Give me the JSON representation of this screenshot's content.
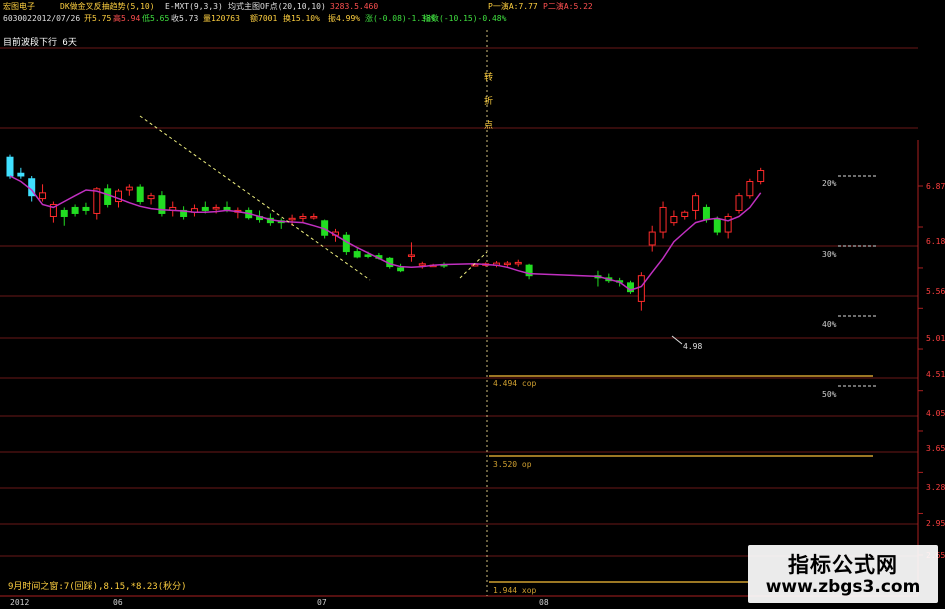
{
  "header": {
    "stock_name": "宏图电子",
    "indicator1": "DK做金叉反抽趋势(5,10)",
    "indicator2": "E-MXT(9,3,3)",
    "indicator3": "均式主图OF点(20,10,10)",
    "indicator3_value": "3283.5.460",
    "right_label1": "P一演A:7.77",
    "right_label2": "P二演A:5.22",
    "code": "603002",
    "date": "2012/07/26",
    "open_label": "开5.75",
    "high_label": "高5.94",
    "low_label": "低5.65",
    "close_label": "收5.73",
    "volume_label": "量120763",
    "amount_label": "额7001",
    "turnover_label": "换15.10%",
    "amplitude_label": "振4.99%",
    "change_label": "涨(-0.08)-1.38%",
    "index_label": "指数(-10.15)-0.48%",
    "trend_label": "目前波段下行 6天"
  },
  "annotations": {
    "turn_label": "转折点",
    "low_price": "4.98",
    "pct_20": "20%",
    "pct_30": "30%",
    "pct_40": "40%",
    "pct_50": "50%",
    "level1": "4.494 cop",
    "level2": "3.520 op",
    "level3": "1.944 xop"
  },
  "price_axis": [
    "6.87",
    "6.18",
    "5.56",
    "5.01",
    "4.51",
    "4.05",
    "3.65",
    "3.28",
    "2.95",
    "2.65"
  ],
  "date_axis": [
    "2012",
    "06",
    "07",
    "08"
  ],
  "footer_text": "9月时间之窗:7(回踩),8.15,*8.23(秋分)",
  "watermark": {
    "line1": "指标公式网",
    "line2": "www.zbgs3.com"
  },
  "colors": {
    "up": "#ff2b2b",
    "down": "#22dd22",
    "ma": "#c030c0",
    "cyan": "#40e0ff",
    "gold": "#d0a030",
    "grid": "#6a1818"
  },
  "chart_data": {
    "type": "candlestick",
    "y_axis_scale": "log",
    "y_ticks": [
      6.87,
      6.18,
      5.56,
      5.01,
      4.51,
      4.05,
      3.65,
      3.28,
      2.95,
      2.65
    ],
    "x_tick_labels": [
      "2012",
      "06",
      "07",
      "08"
    ],
    "candles": [
      {
        "o": 7.4,
        "h": 7.45,
        "l": 7.0,
        "c": 7.05,
        "color": "cyan"
      },
      {
        "o": 7.1,
        "h": 7.2,
        "l": 7.0,
        "c": 7.05,
        "color": "cyan"
      },
      {
        "o": 7.0,
        "h": 7.05,
        "l": 6.6,
        "c": 6.7,
        "color": "cyan"
      },
      {
        "o": 6.75,
        "h": 6.9,
        "l": 6.6,
        "c": 6.65,
        "color": "up"
      },
      {
        "o": 6.55,
        "h": 6.6,
        "l": 6.25,
        "c": 6.35,
        "color": "up"
      },
      {
        "o": 6.35,
        "h": 6.5,
        "l": 6.2,
        "c": 6.45,
        "color": "down"
      },
      {
        "o": 6.5,
        "h": 6.55,
        "l": 6.35,
        "c": 6.4,
        "color": "down"
      },
      {
        "o": 6.5,
        "h": 6.58,
        "l": 6.38,
        "c": 6.45,
        "color": "down"
      },
      {
        "o": 6.4,
        "h": 6.85,
        "l": 6.3,
        "c": 6.82,
        "color": "up"
      },
      {
        "o": 6.82,
        "h": 6.9,
        "l": 6.5,
        "c": 6.55,
        "color": "down"
      },
      {
        "o": 6.6,
        "h": 6.82,
        "l": 6.5,
        "c": 6.78,
        "color": "up"
      },
      {
        "o": 6.8,
        "h": 6.9,
        "l": 6.7,
        "c": 6.85,
        "color": "up"
      },
      {
        "o": 6.85,
        "h": 6.9,
        "l": 6.55,
        "c": 6.6,
        "color": "down"
      },
      {
        "o": 6.65,
        "h": 6.75,
        "l": 6.55,
        "c": 6.7,
        "color": "up"
      },
      {
        "o": 6.7,
        "h": 6.78,
        "l": 6.35,
        "c": 6.4,
        "color": "down"
      },
      {
        "o": 6.45,
        "h": 6.6,
        "l": 6.35,
        "c": 6.5,
        "color": "up"
      },
      {
        "o": 6.45,
        "h": 6.52,
        "l": 6.3,
        "c": 6.35,
        "color": "down"
      },
      {
        "o": 6.42,
        "h": 6.55,
        "l": 6.35,
        "c": 6.48,
        "color": "up"
      },
      {
        "o": 6.5,
        "h": 6.6,
        "l": 6.4,
        "c": 6.45,
        "color": "down"
      },
      {
        "o": 6.48,
        "h": 6.55,
        "l": 6.4,
        "c": 6.5,
        "color": "up"
      },
      {
        "o": 6.5,
        "h": 6.6,
        "l": 6.42,
        "c": 6.45,
        "color": "down"
      },
      {
        "o": 6.42,
        "h": 6.5,
        "l": 6.32,
        "c": 6.45,
        "color": "up"
      },
      {
        "o": 6.45,
        "h": 6.5,
        "l": 6.3,
        "c": 6.33,
        "color": "down"
      },
      {
        "o": 6.35,
        "h": 6.45,
        "l": 6.25,
        "c": 6.3,
        "color": "down"
      },
      {
        "o": 6.32,
        "h": 6.4,
        "l": 6.2,
        "c": 6.25,
        "color": "down"
      },
      {
        "o": 6.25,
        "h": 6.32,
        "l": 6.15,
        "c": 6.28,
        "color": "down"
      },
      {
        "o": 6.3,
        "h": 6.38,
        "l": 6.2,
        "c": 6.32,
        "color": "up"
      },
      {
        "o": 6.32,
        "h": 6.4,
        "l": 6.25,
        "c": 6.35,
        "color": "up"
      },
      {
        "o": 6.35,
        "h": 6.4,
        "l": 6.3,
        "c": 6.33,
        "color": "up"
      },
      {
        "o": 6.28,
        "h": 6.3,
        "l": 6.0,
        "c": 6.05,
        "color": "down"
      },
      {
        "o": 6.05,
        "h": 6.15,
        "l": 5.95,
        "c": 6.1,
        "color": "up"
      },
      {
        "o": 6.05,
        "h": 6.1,
        "l": 5.75,
        "c": 5.8,
        "color": "down"
      },
      {
        "o": 5.8,
        "h": 5.85,
        "l": 5.7,
        "c": 5.72,
        "color": "down"
      },
      {
        "o": 5.75,
        "h": 5.8,
        "l": 5.7,
        "c": 5.74,
        "color": "down"
      },
      {
        "o": 5.74,
        "h": 5.78,
        "l": 5.68,
        "c": 5.7,
        "color": "down"
      },
      {
        "o": 5.7,
        "h": 5.72,
        "l": 5.55,
        "c": 5.58,
        "color": "down"
      },
      {
        "o": 5.56,
        "h": 5.62,
        "l": 5.5,
        "c": 5.52,
        "color": "down"
      },
      {
        "o": 5.75,
        "h": 5.94,
        "l": 5.65,
        "c": 5.73,
        "color": "up"
      },
      {
        "o": 5.6,
        "h": 5.65,
        "l": 5.55,
        "c": 5.62,
        "color": "up"
      },
      {
        "o": 5.6,
        "h": 5.62,
        "l": 5.58,
        "c": 5.6,
        "color": "up"
      },
      {
        "o": 5.6,
        "h": 5.64,
        "l": 5.56,
        "c": 5.61,
        "color": "down"
      },
      {
        "o": 5.6,
        "h": 5.63,
        "l": 5.58,
        "c": 5.61,
        "color": "up"
      },
      {
        "o": 5.61,
        "h": 5.64,
        "l": 5.58,
        "c": 5.62,
        "color": "up"
      },
      {
        "o": 5.6,
        "h": 5.66,
        "l": 5.57,
        "c": 5.63,
        "color": "up"
      },
      {
        "o": 5.62,
        "h": 5.66,
        "l": 5.58,
        "c": 5.63,
        "color": "up"
      },
      {
        "o": 5.62,
        "h": 5.68,
        "l": 5.58,
        "c": 5.64,
        "color": "up"
      },
      {
        "o": 5.6,
        "h": 5.62,
        "l": 5.4,
        "c": 5.45,
        "color": "down"
      },
      {
        "o": 5.45,
        "h": 5.52,
        "l": 5.3,
        "c": 5.42,
        "color": "down"
      },
      {
        "o": 5.42,
        "h": 5.48,
        "l": 5.35,
        "c": 5.38,
        "color": "down"
      },
      {
        "o": 5.38,
        "h": 5.42,
        "l": 5.3,
        "c": 5.36,
        "color": "down"
      },
      {
        "o": 5.35,
        "h": 5.38,
        "l": 5.2,
        "c": 5.23,
        "color": "down"
      },
      {
        "o": 5.1,
        "h": 5.5,
        "l": 4.98,
        "c": 5.45,
        "color": "up"
      },
      {
        "o": 5.9,
        "h": 6.2,
        "l": 5.8,
        "c": 6.1,
        "color": "up"
      },
      {
        "o": 6.1,
        "h": 6.6,
        "l": 6.0,
        "c": 6.5,
        "color": "up"
      },
      {
        "o": 6.35,
        "h": 6.45,
        "l": 6.2,
        "c": 6.25,
        "color": "up"
      },
      {
        "o": 6.35,
        "h": 6.45,
        "l": 6.3,
        "c": 6.42,
        "color": "up"
      },
      {
        "o": 6.45,
        "h": 6.75,
        "l": 6.3,
        "c": 6.7,
        "color": "up"
      },
      {
        "o": 6.5,
        "h": 6.55,
        "l": 6.25,
        "c": 6.3,
        "color": "down"
      },
      {
        "o": 6.3,
        "h": 6.35,
        "l": 6.05,
        "c": 6.1,
        "color": "down"
      },
      {
        "o": 6.1,
        "h": 6.4,
        "l": 6.0,
        "c": 6.35,
        "color": "up"
      },
      {
        "o": 6.45,
        "h": 6.75,
        "l": 6.4,
        "c": 6.7,
        "color": "up"
      },
      {
        "o": 6.7,
        "h": 7.0,
        "l": 6.65,
        "c": 6.95,
        "color": "up"
      },
      {
        "o": 6.95,
        "h": 7.2,
        "l": 6.9,
        "c": 7.15,
        "color": "up"
      }
    ],
    "ma_line": [
      7.05,
      6.95,
      6.8,
      6.55,
      6.5,
      6.6,
      6.7,
      6.8,
      6.78,
      6.72,
      6.65,
      6.58,
      6.52,
      6.48,
      6.46,
      6.45,
      6.44,
      6.42,
      6.42,
      6.43,
      6.45,
      6.43,
      6.4,
      6.35,
      6.3,
      6.27,
      6.26,
      6.25,
      6.2,
      6.15,
      6.05,
      5.95,
      5.86,
      5.78,
      5.7,
      5.62,
      5.58,
      5.57,
      5.58,
      5.6,
      5.61,
      5.62,
      5.61,
      5.6,
      5.57,
      5.52,
      5.48,
      5.44,
      5.4,
      5.36,
      5.25,
      5.3,
      5.5,
      5.7,
      5.95,
      6.1,
      6.25,
      6.3,
      6.32,
      6.28,
      6.35,
      6.5,
      6.75
    ],
    "horizontal_levels": [
      4.494,
      3.52,
      1.944
    ]
  }
}
